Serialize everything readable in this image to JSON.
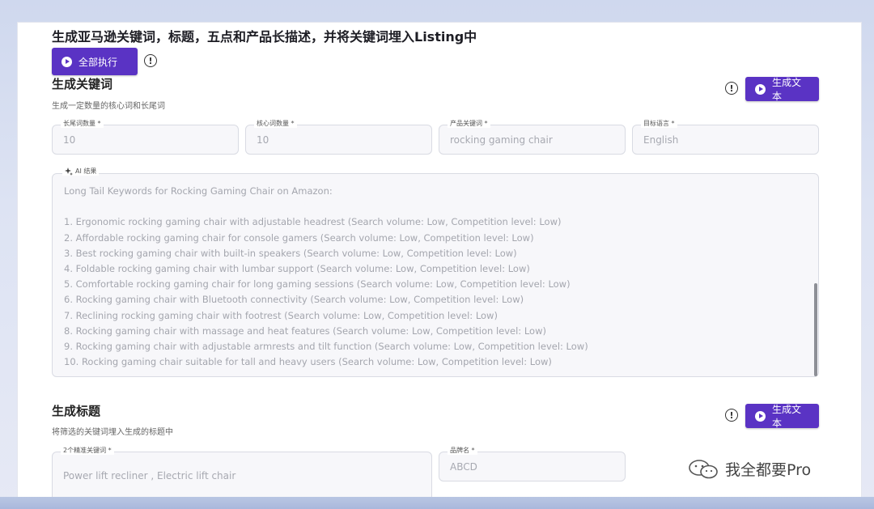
{
  "page": {
    "title": "生成亚马逊关键词，标题，五点和产品长描述，并将关键词埋入Listing中",
    "run_all_label": "全部执行"
  },
  "keywords_section": {
    "title": "生成关键词",
    "description": "生成一定数量的核心词和长尾词",
    "generate_label": "生成文本",
    "fields": [
      {
        "label": "长尾词数量 *",
        "value": "10"
      },
      {
        "label": "核心词数量 *",
        "value": "10"
      },
      {
        "label": "产品关键词 *",
        "value": "rocking gaming chair"
      },
      {
        "label": "目标语言 *",
        "value": "English"
      }
    ],
    "result": {
      "label": "AI 结果",
      "text": "Long Tail Keywords for Rocking Gaming Chair on Amazon:\n\n1. Ergonomic rocking gaming chair with adjustable headrest (Search volume: Low, Competition level: Low)\n2. Affordable rocking gaming chair for console gamers (Search volume: Low, Competition level: Low)\n3. Best rocking gaming chair with built-in speakers (Search volume: Low, Competition level: Low)\n4. Foldable rocking gaming chair with lumbar support (Search volume: Low, Competition level: Low)\n5. Comfortable rocking gaming chair for long gaming sessions (Search volume: Low, Competition level: Low)\n6. Rocking gaming chair with Bluetooth connectivity (Search volume: Low, Competition level: Low)\n7. Reclining rocking gaming chair with footrest (Search volume: Low, Competition level: Low)\n8. Rocking gaming chair with massage and heat features (Search volume: Low, Competition level: Low)\n9. Rocking gaming chair with adjustable armrests and tilt function (Search volume: Low, Competition level: Low)\n10. Rocking gaming chair suitable for tall and heavy users (Search volume: Low, Competition level: Low)"
    }
  },
  "title_section": {
    "title": "生成标题",
    "description": "将筛选的关键词埋入生成的标题中",
    "generate_label": "生成文本",
    "fields": [
      {
        "label": "2个精准关键词 *",
        "value": "Power lift recliner ,  Electric lift chair"
      },
      {
        "label": "品牌名 *",
        "value": "ABCD"
      }
    ]
  },
  "watermark": {
    "text": "我全都要Pro"
  }
}
